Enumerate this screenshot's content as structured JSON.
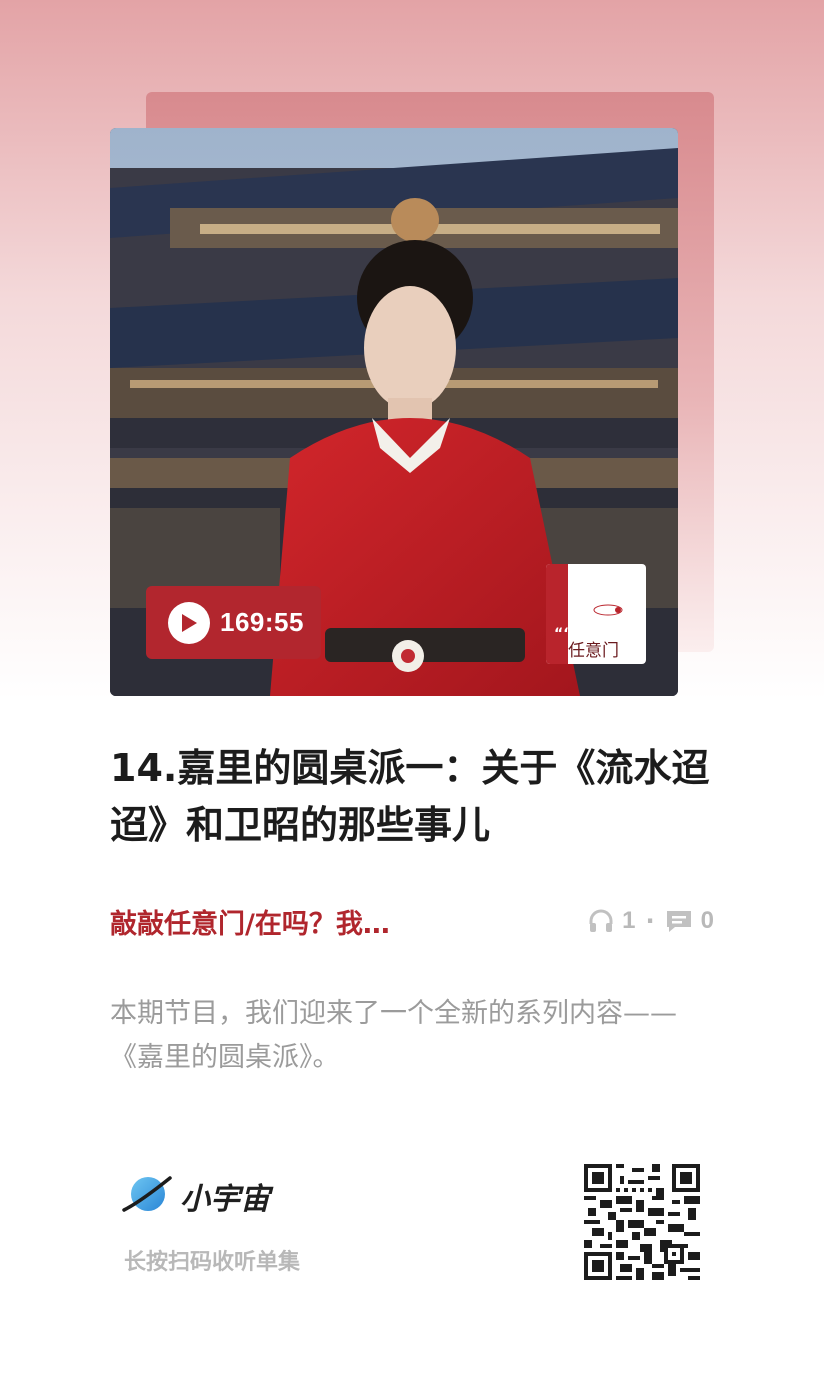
{
  "cover": {
    "duration": "169:55"
  },
  "thumbnail": {
    "title": "任意门",
    "quote_mark": "““"
  },
  "episode": {
    "title": "14.嘉里的圆桌派一：关于《流水迢迢》和卫昭的那些事儿"
  },
  "meta": {
    "podcast_name": "敲敲任意门/在吗？我…",
    "listen_count": "1",
    "separator": "·",
    "comment_count": "0"
  },
  "description": "本期节目，我们迎来了一个全新的系列内容——《嘉里的圆桌派》。",
  "brand": {
    "name": "小宇宙",
    "scan_hint": "长按扫码收听单集"
  },
  "colors": {
    "accent": "#b0262d",
    "duration_bg": "#b2262e",
    "brand_planet": "#3a9be0"
  },
  "icons": {
    "play": "play-icon",
    "listens": "headphones-icon",
    "comments": "comment-icon",
    "logo": "planet-icon"
  }
}
